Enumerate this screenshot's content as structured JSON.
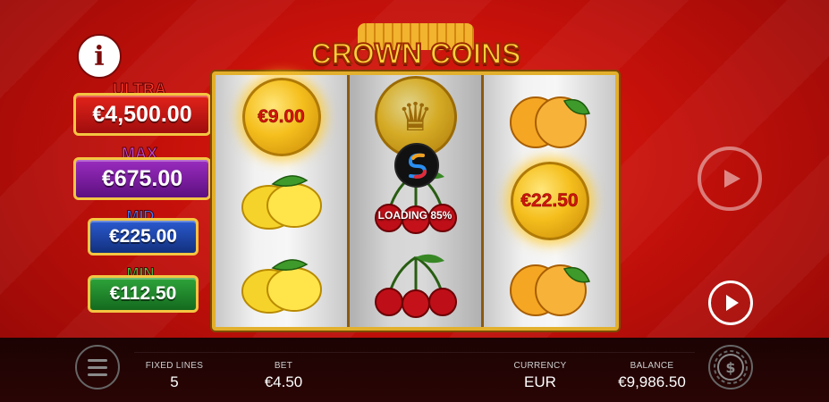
{
  "game": {
    "logo_text": "CROWN COINS"
  },
  "jackpots": [
    {
      "label": "ULTRA",
      "value": "€4,500.00"
    },
    {
      "label": "MAX",
      "value": "€675.00"
    },
    {
      "label": "MID",
      "value": "€225.00"
    },
    {
      "label": "MIN",
      "value": "€112.50"
    }
  ],
  "reels": {
    "reel1": [
      "coin",
      "lemon",
      "lemon"
    ],
    "reel2": [
      "crown-coin",
      "cherry",
      "cherry"
    ],
    "reel3": [
      "orange",
      "coin",
      "orange"
    ],
    "coin_values": {
      "reel1_top": "€9.00",
      "reel3_middle": "€22.50"
    }
  },
  "loading": {
    "text": "LOADING 85%",
    "progress": 0.85
  },
  "bottom_bar": {
    "fixed_lines_label": "FIXED LINES",
    "fixed_lines_value": "5",
    "bet_label": "BET",
    "bet_value": "€4.50",
    "currency_label": "CURRENCY",
    "currency_value": "EUR",
    "balance_label": "BALANCE",
    "balance_value": "€9,986.50"
  },
  "icons": {
    "info": "info-icon",
    "autoplay": "autoplay-icon",
    "spin": "spin-icon",
    "menu": "menu-icon",
    "bet": "coin-stack-icon"
  },
  "colors": {
    "ultra": "#c8141a",
    "max": "#7a1d9a",
    "mid": "#1840a8",
    "min": "#1f8a2a",
    "gold": "#e3b02d"
  }
}
